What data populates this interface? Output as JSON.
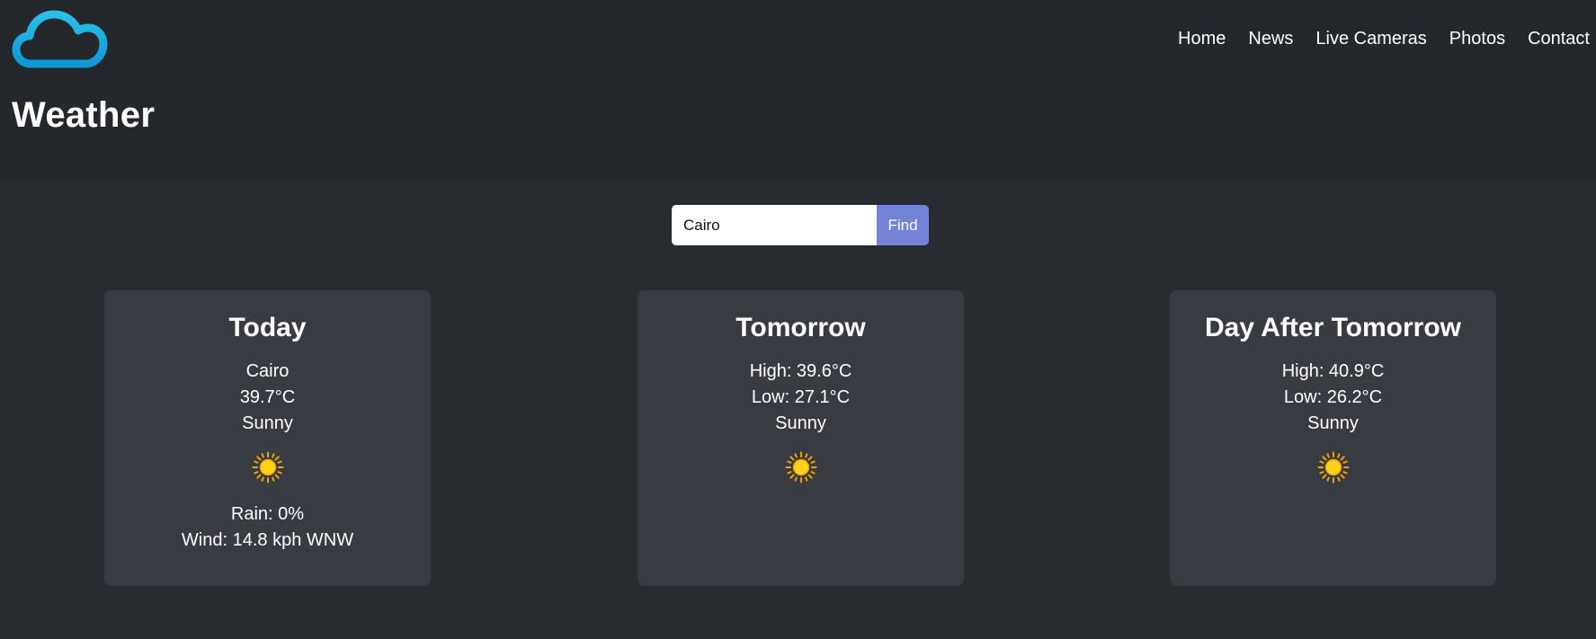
{
  "header": {
    "logo_icon": "cloud-icon",
    "title": "Weather",
    "accent_color": "#1aa8df"
  },
  "nav": {
    "items": [
      {
        "label": "Home"
      },
      {
        "label": "News"
      },
      {
        "label": "Live Cameras"
      },
      {
        "label": "Photos"
      },
      {
        "label": "Contact"
      }
    ]
  },
  "search": {
    "value": "Cairo",
    "button_label": "Find",
    "button_color": "#7483d6"
  },
  "forecast": {
    "today": {
      "title": "Today",
      "city": "Cairo",
      "temp": "39.7°C",
      "condition": "Sunny",
      "icon": "sun-icon",
      "rain": "Rain: 0%",
      "wind": "Wind: 14.8 kph WNW"
    },
    "tomorrow": {
      "title": "Tomorrow",
      "high": "High: 39.6°C",
      "low": "Low: 27.1°C",
      "condition": "Sunny",
      "icon": "sun-icon"
    },
    "day_after": {
      "title": "Day After Tomorrow",
      "high": "High: 40.9°C",
      "low": "Low: 26.2°C",
      "condition": "Sunny",
      "icon": "sun-icon"
    }
  }
}
